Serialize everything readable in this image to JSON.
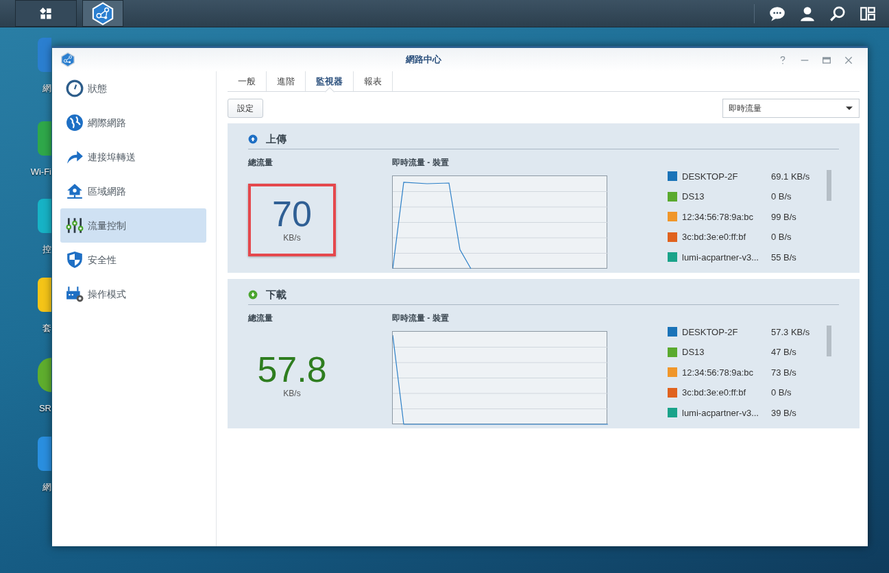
{
  "taskbar": {
    "buttons": [
      {
        "kind": "apps",
        "selected": false
      },
      {
        "kind": "network",
        "selected": true
      }
    ],
    "tray": [
      {
        "kind": "chat"
      },
      {
        "kind": "user"
      },
      {
        "kind": "search"
      },
      {
        "kind": "widgets"
      }
    ]
  },
  "desktop_icons": [
    {
      "kind": "network",
      "label": "網"
    },
    {
      "kind": "wifi",
      "label": "Wi-Fi"
    },
    {
      "kind": "control",
      "label": "控"
    },
    {
      "kind": "package",
      "label": "套"
    },
    {
      "kind": "help",
      "label": "SR"
    },
    {
      "kind": "tools",
      "label": "網"
    }
  ],
  "window": {
    "title": "網路中心"
  },
  "sidebar": {
    "items": [
      {
        "kind": "status",
        "label": "狀態",
        "selected": false
      },
      {
        "kind": "internet",
        "label": "網際網路",
        "selected": false
      },
      {
        "kind": "forwarding",
        "label": "連接埠轉送",
        "selected": false
      },
      {
        "kind": "lan",
        "label": "區域網路",
        "selected": false
      },
      {
        "kind": "traffic",
        "label": "流量控制",
        "selected": true
      },
      {
        "kind": "security",
        "label": "安全性",
        "selected": false
      },
      {
        "kind": "mode",
        "label": "操作模式",
        "selected": false
      }
    ]
  },
  "tabs": [
    {
      "label": "一般",
      "selected": false
    },
    {
      "label": "進階",
      "selected": false
    },
    {
      "label": "監視器",
      "selected": true
    },
    {
      "label": "報表",
      "selected": false
    }
  ],
  "toolbar": {
    "settings_button": "設定",
    "view_select": "即時流量"
  },
  "panels": [
    {
      "kind": "upload",
      "title": "上傳",
      "total_label": "總流量",
      "total_value": "70",
      "unit": "KB/s",
      "highlighted": true,
      "chart_title": "即時流量 - 裝置",
      "devices": [
        {
          "name": "DESKTOP-2F",
          "rate": "69.1 KB/s",
          "color": "#1a73b8"
        },
        {
          "name": "DS13",
          "rate": "0 B/s",
          "color": "#5aaa2e"
        },
        {
          "name": "12:34:56:78:9a:bc",
          "rate": "99 B/s",
          "color": "#f0962a"
        },
        {
          "name": "3c:bd:3e:e0:ff:bf",
          "rate": "0 B/s",
          "color": "#e0621e"
        },
        {
          "name": "lumi-acpartner-v3...",
          "rate": "55 B/s",
          "color": "#1aa38a"
        }
      ]
    },
    {
      "kind": "download",
      "title": "下載",
      "total_label": "總流量",
      "total_value": "57.8",
      "unit": "KB/s",
      "highlighted": false,
      "chart_title": "即時流量 - 裝置",
      "devices": [
        {
          "name": "DESKTOP-2F",
          "rate": "57.3 KB/s",
          "color": "#1a73b8"
        },
        {
          "name": "DS13",
          "rate": "47 B/s",
          "color": "#5aaa2e"
        },
        {
          "name": "12:34:56:78:9a:bc",
          "rate": "73 B/s",
          "color": "#f0962a"
        },
        {
          "name": "3c:bd:3e:e0:ff:bf",
          "rate": "0 B/s",
          "color": "#e0621e"
        },
        {
          "name": "lumi-acpartner-v3...",
          "rate": "39 B/s",
          "color": "#1aa38a"
        }
      ]
    }
  ]
}
